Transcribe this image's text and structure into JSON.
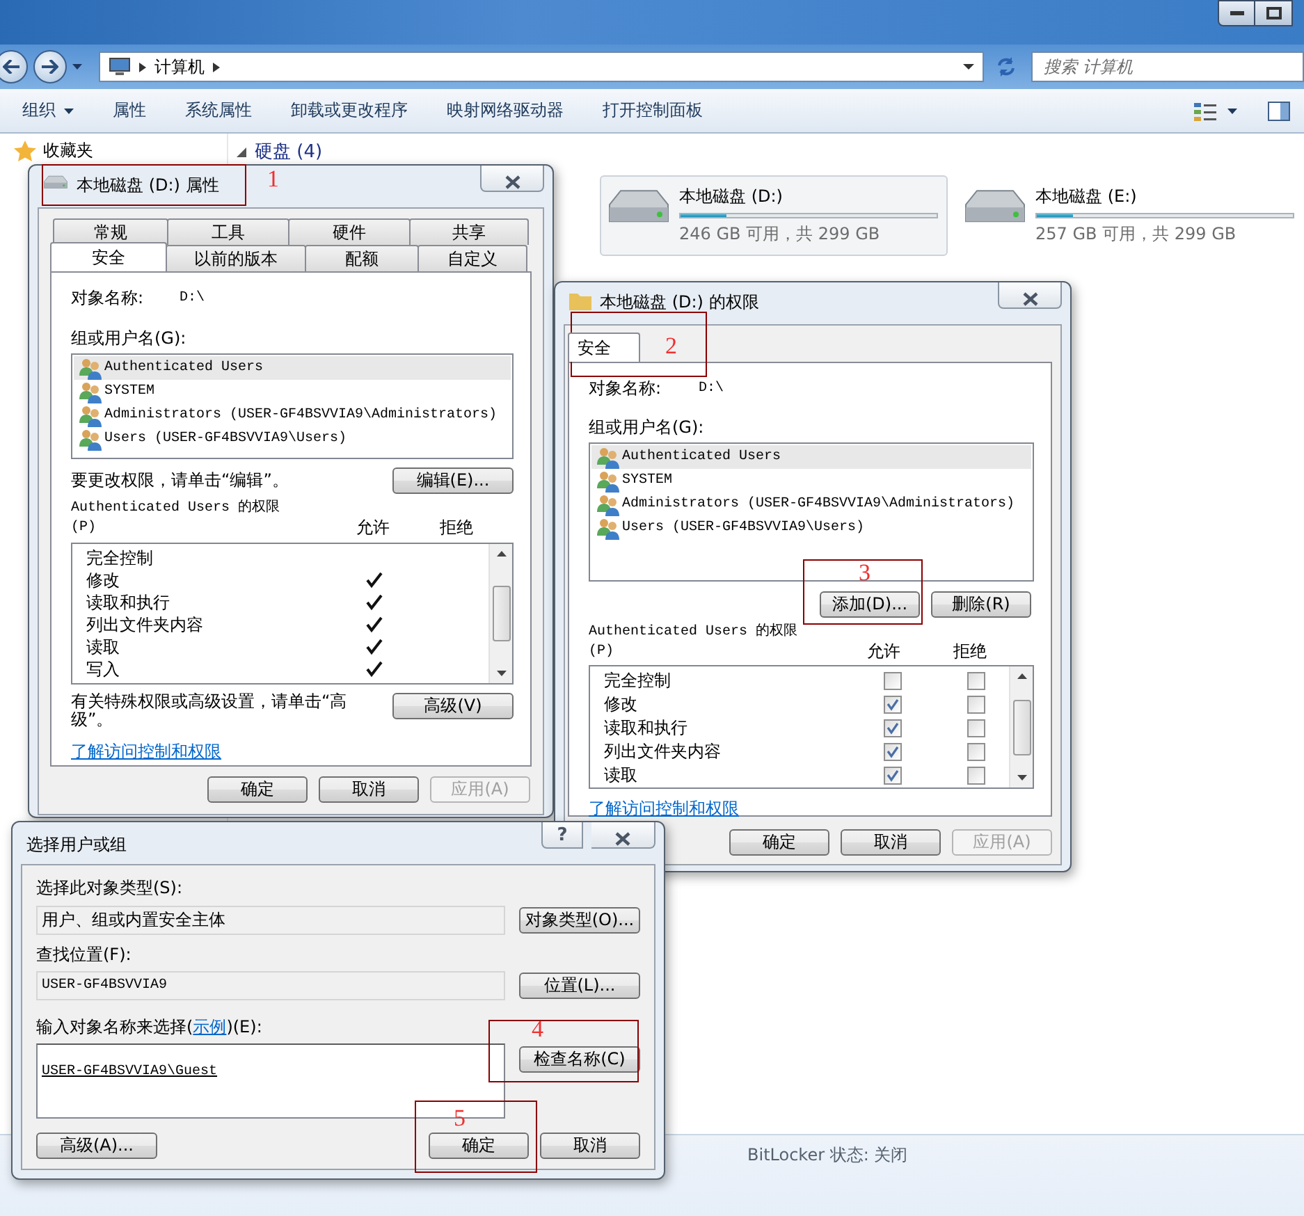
{
  "explorer": {
    "address": {
      "path": [
        "计算机"
      ]
    },
    "search": {
      "placeholder": "搜索 计算机"
    },
    "toolbar": [
      {
        "label": "组织",
        "kind": "menu"
      },
      {
        "label": "属性",
        "kind": "button"
      },
      {
        "label": "系统属性",
        "kind": "button"
      },
      {
        "label": "卸载或更改程序",
        "kind": "button"
      },
      {
        "label": "映射网络驱动器",
        "kind": "button"
      },
      {
        "label": "打开控制面板",
        "kind": "button"
      }
    ],
    "navigation": [
      {
        "label": "收藏夹"
      }
    ],
    "section": {
      "title": "硬盘 (4)"
    },
    "drives": [
      {
        "name": "本地磁盘 (D:)",
        "free": "246 GB 可用，共 299 GB",
        "level": 0.18,
        "selected": true
      },
      {
        "name": "本地磁盘 (E:)",
        "free": "257 GB 可用，共 299 GB",
        "level": 0.14,
        "selected": false
      }
    ],
    "details": {
      "bitlocker": "BitLocker 状态: 关闭"
    }
  },
  "properties_dialog": {
    "title": "本地磁盘 (D:) 属性",
    "tab_rows": [
      [
        {
          "label": "常规",
          "selected": false
        },
        {
          "label": "工具",
          "selected": false
        },
        {
          "label": "硬件",
          "selected": false
        },
        {
          "label": "共享",
          "selected": false
        }
      ],
      [
        {
          "label": "安全",
          "selected": true
        },
        {
          "label": "以前的版本",
          "selected": false
        },
        {
          "label": "配额",
          "selected": false
        },
        {
          "label": "自定义",
          "selected": false
        }
      ]
    ],
    "object_label": "对象名称:",
    "object_value": "D:\\",
    "group_label": "组或用户名(G):",
    "users": [
      {
        "name": "Authenticated Users",
        "selected": true
      },
      {
        "name": "SYSTEM",
        "selected": false
      },
      {
        "name": "Administrators (USER-GF4BSVVIA9\\Administrators)",
        "selected": false
      },
      {
        "name": "Users (USER-GF4BSVVIA9\\Users)",
        "selected": false
      }
    ],
    "edit_hint": "要更改权限，请单击“编辑”。",
    "edit_button": "编辑(E)...",
    "permissions_label": "Authenticated Users 的权限",
    "permissions_key": "(P)",
    "allow_header": "允许",
    "deny_header": "拒绝",
    "permissions": [
      {
        "name": "完全控制",
        "allow": false
      },
      {
        "name": "修改",
        "allow": true
      },
      {
        "name": "读取和执行",
        "allow": true
      },
      {
        "name": "列出文件夹内容",
        "allow": true
      },
      {
        "name": "读取",
        "allow": true
      },
      {
        "name": "写入",
        "allow": true
      }
    ],
    "advanced_hint": "有关特殊权限或高级设置，请单击“高级”。",
    "advanced_button": "高级(V)",
    "link": "了解访问控制和权限",
    "buttons": [
      {
        "label": "确定",
        "disabled": false
      },
      {
        "label": "取消",
        "disabled": false
      },
      {
        "label": "应用(A)",
        "disabled": true
      }
    ]
  },
  "permissions_dialog": {
    "title": "本地磁盘 (D:) 的权限",
    "tabs": [
      {
        "label": "安全",
        "selected": true
      }
    ],
    "object_label": "对象名称:",
    "object_value": "D:\\",
    "group_label": "组或用户名(G):",
    "users": [
      {
        "name": "Authenticated Users",
        "selected": true
      },
      {
        "name": "SYSTEM",
        "selected": false
      },
      {
        "name": "Administrators (USER-GF4BSVVIA9\\Administrators)",
        "selected": false
      },
      {
        "name": "Users (USER-GF4BSVVIA9\\Users)",
        "selected": false
      }
    ],
    "add_button": "添加(D)...",
    "remove_button": "删除(R)",
    "permissions_label": "Authenticated Users 的权限",
    "permissions_key": "(P)",
    "allow_header": "允许",
    "deny_header": "拒绝",
    "permissions": [
      {
        "name": "完全控制",
        "allow": false,
        "deny": false
      },
      {
        "name": "修改",
        "allow": true,
        "deny": false
      },
      {
        "name": "读取和执行",
        "allow": true,
        "deny": false
      },
      {
        "name": "列出文件夹内容",
        "allow": true,
        "deny": false
      },
      {
        "name": "读取",
        "allow": true,
        "deny": false
      }
    ],
    "link": "了解访问控制和权限",
    "buttons": [
      {
        "label": "确定",
        "disabled": false
      },
      {
        "label": "取消",
        "disabled": false
      },
      {
        "label": "应用(A)",
        "disabled": true
      }
    ]
  },
  "select_dialog": {
    "title": "选择用户或组",
    "help": "?",
    "object_type_label": "选择此对象类型(S):",
    "object_type_value": "用户、组或内置安全主体",
    "object_type_button": "对象类型(O)...",
    "location_label": "查找位置(F):",
    "location_value": "USER-GF4BSVVIA9",
    "location_button": "位置(L)...",
    "names_label_before": "输入对象名称来选择(",
    "names_link": "示例",
    "names_label_after": ")(E):",
    "names_value": "USER-GF4BSVVIA9\\Guest",
    "check_button": "检查名称(C)",
    "advanced_button": "高级(A)...",
    "buttons": [
      {
        "label": "确定",
        "disabled": false
      },
      {
        "label": "取消",
        "disabled": false
      }
    ]
  },
  "annotations": [
    {
      "label": "1"
    },
    {
      "label": "2"
    },
    {
      "label": "3"
    },
    {
      "label": "4"
    },
    {
      "label": "5"
    }
  ]
}
